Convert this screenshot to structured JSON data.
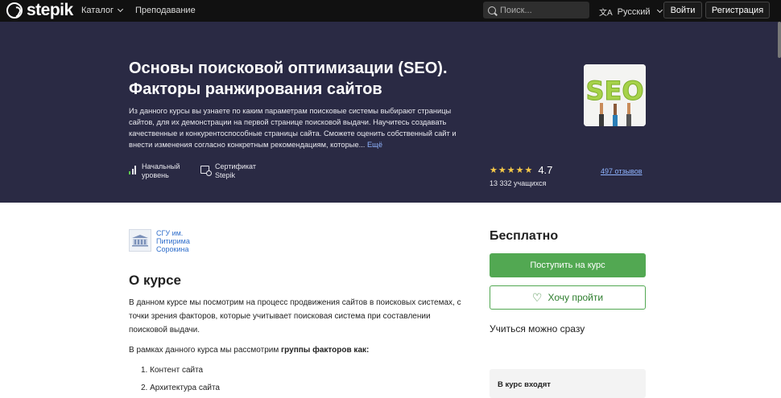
{
  "nav": {
    "logo": "stepik",
    "catalog": "Каталог",
    "teaching": "Преподавание",
    "search_placeholder": "Поиск...",
    "language": "Русский",
    "login": "Войти",
    "register": "Регистрация"
  },
  "hero": {
    "title_line1": "Основы поисковой оптимизации (SEO).",
    "title_line2": "Факторы ранжирования сайтов",
    "description": "Из данного курсы вы узнаете по каким параметрам поисковые системы выбирают страницы сайтов, для их демонстрации на первой странице поисковой выдачи. Научитесь создавать качественные и конкурентоспособные страницы сайта. Сможете оценить собственный сайт и внести изменения согласно конкретным рекомендациям, которые...",
    "more": "Ещё",
    "image_text": "SEO",
    "level_line1": "Начальный",
    "level_line2": "уровень",
    "cert_line1": "Сертификат",
    "cert_line2": "Stepik",
    "stars": "★★★★★",
    "rating": "4.7",
    "rating_value": 4.7,
    "students": "13 332 учащихся",
    "reviews": "497 отзывов"
  },
  "main": {
    "org_line1": "СГУ им.",
    "org_line2": "Питирима",
    "org_line3": "Сорокина",
    "about_title": "О курсе",
    "p1": "В данном курсе мы посмотрим на процесс продвижения сайтов в поисковых системах, с точки зрения факторов, которые учитывает поисковая система при составлении поисковой выдачи.",
    "p2_start": "В рамках данного курса мы рассмотрим ",
    "p2_bold": "группы факторов как:",
    "list": [
      "1. Контент сайта",
      "2. Архитектура сайта"
    ]
  },
  "sidebar": {
    "price": "Бесплатно",
    "enroll": "Поступить на курс",
    "wish": "Хочу пройти",
    "start_now": "Учиться можно сразу",
    "includes": "В курс входят"
  },
  "colors": {
    "hero_bg": "#2a2a44",
    "accent_green": "#52a852",
    "link_blue": "#8fb4ff",
    "star_yellow": "#f7c948"
  }
}
